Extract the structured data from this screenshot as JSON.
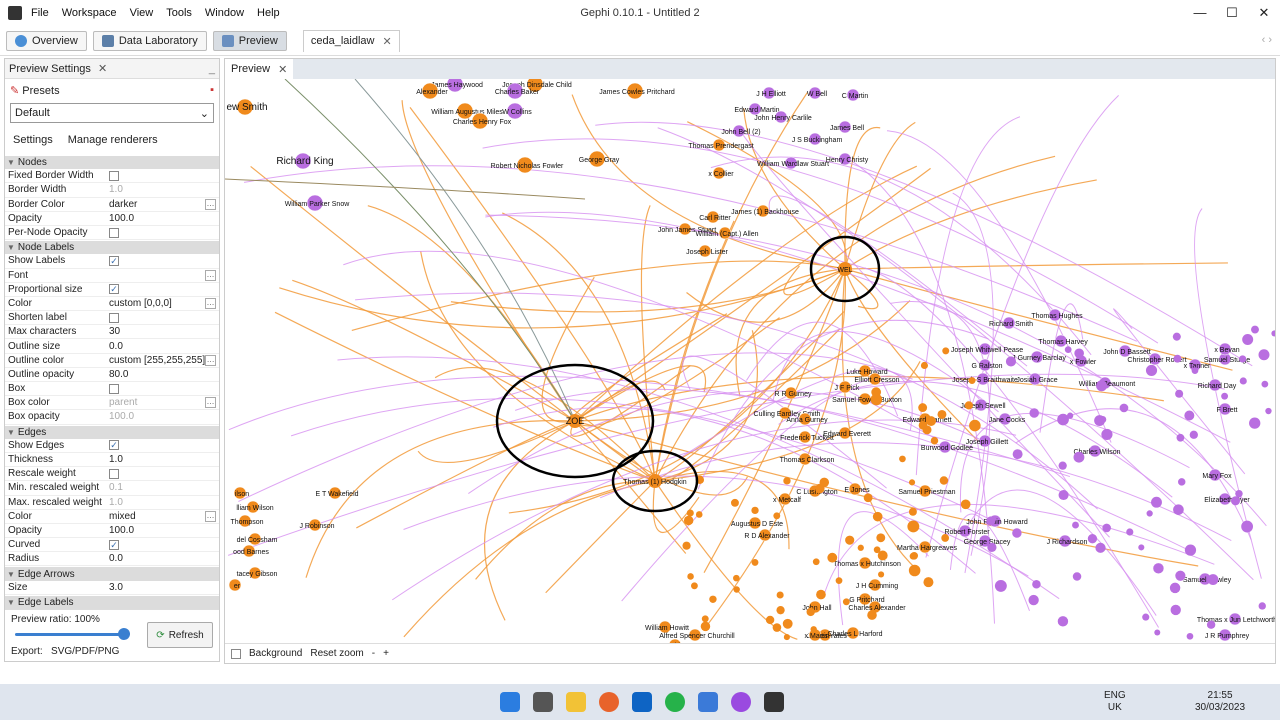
{
  "app": {
    "title": "Gephi 0.10.1 - Untitled 2",
    "menu": [
      "File",
      "Workspace",
      "View",
      "Tools",
      "Window",
      "Help"
    ],
    "window_controls": [
      "—",
      "☐",
      "✕"
    ]
  },
  "toolbar": {
    "modes": [
      "Overview",
      "Data Laboratory",
      "Preview"
    ],
    "workspace_tab": "ceda_laidlaw",
    "nav": "‹ ›"
  },
  "left_panel": {
    "tab_title": "Preview Settings",
    "presets_label": "Presets",
    "preset_value": "Default",
    "subtabs": [
      "Settings",
      "Manage renderers"
    ],
    "sections": [
      {
        "title": "Nodes",
        "rows": [
          {
            "k": "Fixed Border Width",
            "type": "check",
            "checked": false
          },
          {
            "k": "Border Width",
            "type": "text",
            "v": "1.0",
            "dim": true
          },
          {
            "k": "Border Color",
            "type": "text",
            "v": "darker",
            "dots": true
          },
          {
            "k": "Opacity",
            "type": "text",
            "v": "100.0"
          },
          {
            "k": "Per-Node Opacity",
            "type": "check",
            "checked": false
          }
        ]
      },
      {
        "title": "Node Labels",
        "rows": [
          {
            "k": "Show Labels",
            "type": "check",
            "checked": true
          },
          {
            "k": "Font",
            "type": "text",
            "v": "",
            "dots": true
          },
          {
            "k": "Proportional size",
            "type": "check",
            "checked": true
          },
          {
            "k": "Color",
            "type": "text",
            "v": "custom [0,0,0]",
            "dots": true
          },
          {
            "k": "Shorten label",
            "type": "check",
            "checked": false
          },
          {
            "k": "Max characters",
            "type": "text",
            "v": "30"
          },
          {
            "k": "Outline size",
            "type": "text",
            "v": "0.0"
          },
          {
            "k": "Outline color",
            "type": "text",
            "v": "custom [255,255,255]",
            "dots": true
          },
          {
            "k": "Outline opacity",
            "type": "text",
            "v": "80.0"
          },
          {
            "k": "Box",
            "type": "check",
            "checked": false
          },
          {
            "k": "Box color",
            "type": "text",
            "v": "parent",
            "dim": true,
            "dots": true
          },
          {
            "k": "Box opacity",
            "type": "text",
            "v": "100.0",
            "dim": true
          }
        ]
      },
      {
        "title": "Edges",
        "rows": [
          {
            "k": "Show Edges",
            "type": "check",
            "checked": true
          },
          {
            "k": "Thickness",
            "type": "text",
            "v": "1.0"
          },
          {
            "k": "Rescale weight",
            "type": "check",
            "checked": false
          },
          {
            "k": "Min. rescaled weight",
            "type": "text",
            "v": "0.1",
            "dim": true
          },
          {
            "k": "Max. rescaled weight",
            "type": "text",
            "v": "1.0",
            "dim": true
          },
          {
            "k": "Color",
            "type": "text",
            "v": "mixed",
            "dots": true
          },
          {
            "k": "Opacity",
            "type": "text",
            "v": "100.0"
          },
          {
            "k": "Curved",
            "type": "check",
            "checked": true
          },
          {
            "k": "Radius",
            "type": "text",
            "v": "0.0"
          }
        ]
      },
      {
        "title": "Edge Arrows",
        "rows": [
          {
            "k": "Size",
            "type": "text",
            "v": "3.0"
          }
        ]
      },
      {
        "title": "Edge Labels",
        "rows": []
      }
    ],
    "preview_ratio": "Preview ratio: 100%",
    "ratio_value": 1.0,
    "refresh_label": "Refresh",
    "export_label": "Export:",
    "export_formats": "SVG/PDF/PNG"
  },
  "preview": {
    "tab_title": "Preview",
    "bottom": {
      "background": "Background",
      "reset_zoom": "Reset zoom",
      "minus": "-",
      "plus": "+"
    },
    "hubs": [
      "ZOE",
      "WEL",
      "Thomas (1) Hodgkin"
    ],
    "labels": [
      "James Haywood",
      "Joseph Dinsdale Child",
      "Alexander",
      "Charles Baker",
      "James Cowles Pritchard",
      "William Augustus Miles",
      "W Collins",
      "Charles Henry Fox",
      "ew Smith",
      "Richard King",
      "Robert Nicholas Fowler",
      "George Gray",
      "William Parker Snow",
      "John James Stuart",
      "Carl Ritter",
      "James (1) Backhouse",
      "William (Capt.) Allen",
      "Joseph Lister",
      "J H Elliott",
      "W Bell",
      "C Martin",
      "Edward Martin",
      "John Henry Carlile",
      "Thomas Prendergast",
      "John Bell (2)",
      "J S Buckingham",
      "James Bell",
      "Henry Christy",
      "x Collier",
      "William Wardlaw Stuart",
      "Thomas Hughes",
      "Richard Smith",
      "Thomas Harvey",
      "Joseph Whitwell Pease",
      "J Gurney Barclay",
      "G Ralston",
      "x Fowler",
      "Josiah Grace",
      "Joseph S Braithwaite",
      "John D Bassett",
      "Christopher Robert",
      "Samuel Sturge",
      "x Tanner",
      "x Bevan",
      "Luke Howard",
      "Elliott Cresson",
      "J F Pick",
      "William Beaumont",
      "R R Gurney",
      "Samuel Fowell Buxton",
      "Richard Day",
      "Joseph Sewell",
      "F Brett",
      "Culling Eardley Smith",
      "Anna Gurney",
      "Edward Garnett",
      "Jane Cocks",
      "Frederick Tuckett",
      "Edward Everett",
      "Thomas Clarkson",
      "Burwood Godlee",
      "Joseph Gillett",
      "Charles Wilson",
      "Elizabeth Dyer",
      "Mary Fox",
      "E T Wakefield",
      "J Robinson",
      "ilson",
      "lliam Wilson",
      "Thompson",
      "del Cossham",
      "ood Barnes",
      "tacey Gibson",
      "er",
      "C Lushington",
      "E Jones",
      "x Metcalf",
      "Augustus D Este",
      "R D Alexander",
      "Samuel Priestman",
      "Martha Hargreaves",
      "Robert Forster",
      "John Rubin Howard",
      "George Stacey",
      "J Richardson",
      "Samuel Bewley",
      "J R Pumphrey",
      "Thomas x Hutchinson",
      "J H Cumming",
      "G Pritchard",
      "John Hall",
      "Charles Alexander",
      "James Yates",
      "Charles L Harford",
      "William Howitt",
      "Alfred Spencer Churchill",
      "S Lushington",
      "x Martin",
      "Thomas x Jun Letchworth"
    ]
  },
  "taskbar": {
    "tray": [
      "ENG",
      "UK"
    ],
    "time": "21:55",
    "date": "30/03/2023"
  },
  "colors": {
    "orange": "#f08a1c",
    "orange_edge": "#f29a3a",
    "purple": "#b96ee0",
    "purple_edge": "#d68ef0",
    "accent": "#3a7fd0"
  }
}
